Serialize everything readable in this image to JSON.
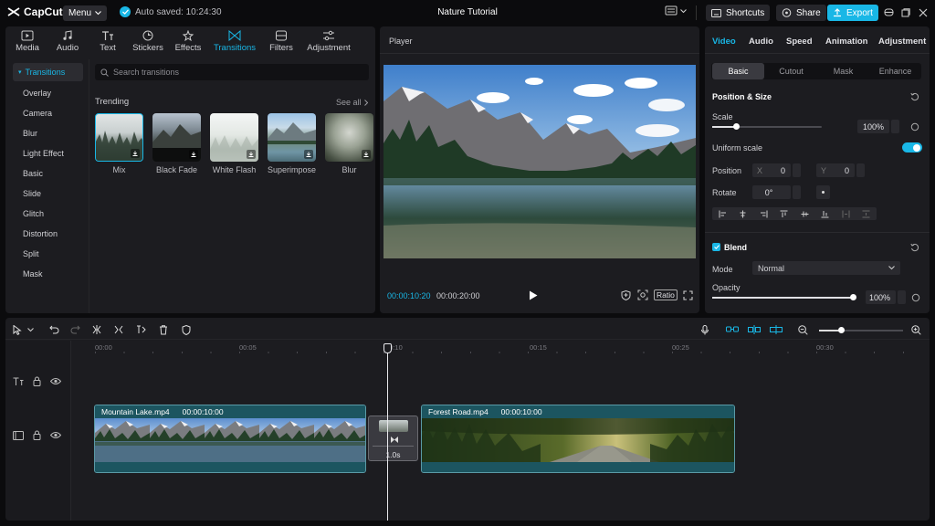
{
  "topbar": {
    "app_name": "CapCut",
    "menu_label": "Menu",
    "autosave_text": "Auto saved: 10:24:30",
    "project_title": "Nature Tutorial",
    "shortcuts_label": "Shortcuts",
    "share_label": "Share",
    "export_label": "Export"
  },
  "media_panel": {
    "tabs": [
      {
        "label": "Media",
        "icon": "media-icon"
      },
      {
        "label": "Audio",
        "icon": "audio-icon"
      },
      {
        "label": "Text",
        "icon": "text-icon"
      },
      {
        "label": "Stickers",
        "icon": "stickers-icon"
      },
      {
        "label": "Effects",
        "icon": "effects-icon"
      },
      {
        "label": "Transitions",
        "icon": "transitions-icon"
      },
      {
        "label": "Filters",
        "icon": "filters-icon"
      },
      {
        "label": "Adjustment",
        "icon": "adjustment-icon"
      }
    ],
    "active_tab": "Transitions",
    "categories": [
      "Transitions",
      "Overlay",
      "Camera",
      "Blur",
      "Light Effect",
      "Basic",
      "Slide",
      "Glitch",
      "Distortion",
      "Split",
      "Mask"
    ],
    "search_placeholder": "Search transitions",
    "section_title": "Trending",
    "see_all": "See all",
    "items": [
      "Mix",
      "Black Fade",
      "White Flash",
      "Superimpose",
      "Blur"
    ]
  },
  "player": {
    "title": "Player",
    "current_time": "00:00:10:20",
    "total_time": "00:00:20:00",
    "ratio_label": "Ratio"
  },
  "inspector": {
    "tabs": [
      "Video",
      "Audio",
      "Speed",
      "Animation",
      "Adjustment"
    ],
    "subtabs": [
      "Basic",
      "Cutout",
      "Mask",
      "Enhance"
    ],
    "position_size_title": "Position & Size",
    "scale_label": "Scale",
    "scale_value": "100%",
    "uniform_scale_label": "Uniform scale",
    "position_label": "Position",
    "x_label": "X",
    "x_value": "0",
    "y_label": "Y",
    "y_value": "0",
    "rotate_label": "Rotate",
    "rotate_value": "0°",
    "blend_title": "Blend",
    "mode_label": "Mode",
    "mode_value": "Normal",
    "opacity_label": "Opacity",
    "opacity_value": "100%",
    "scale_level": 0.22,
    "opacity_level": 1.0
  },
  "timeline": {
    "ruler": [
      "00:00",
      "00:05",
      "00:10",
      "00:15",
      "00:25",
      "00:30"
    ],
    "clips": [
      {
        "name": "Mountain Lake.mp4",
        "duration": "00:00:10:00"
      },
      {
        "name": "Forest Road.mp4",
        "duration": "00:00:10:00"
      }
    ],
    "transition_duration": "1.0s"
  },
  "colors": {
    "accent": "#19b7e6",
    "panel": "#1c1c20",
    "clip": "#1c5560"
  }
}
